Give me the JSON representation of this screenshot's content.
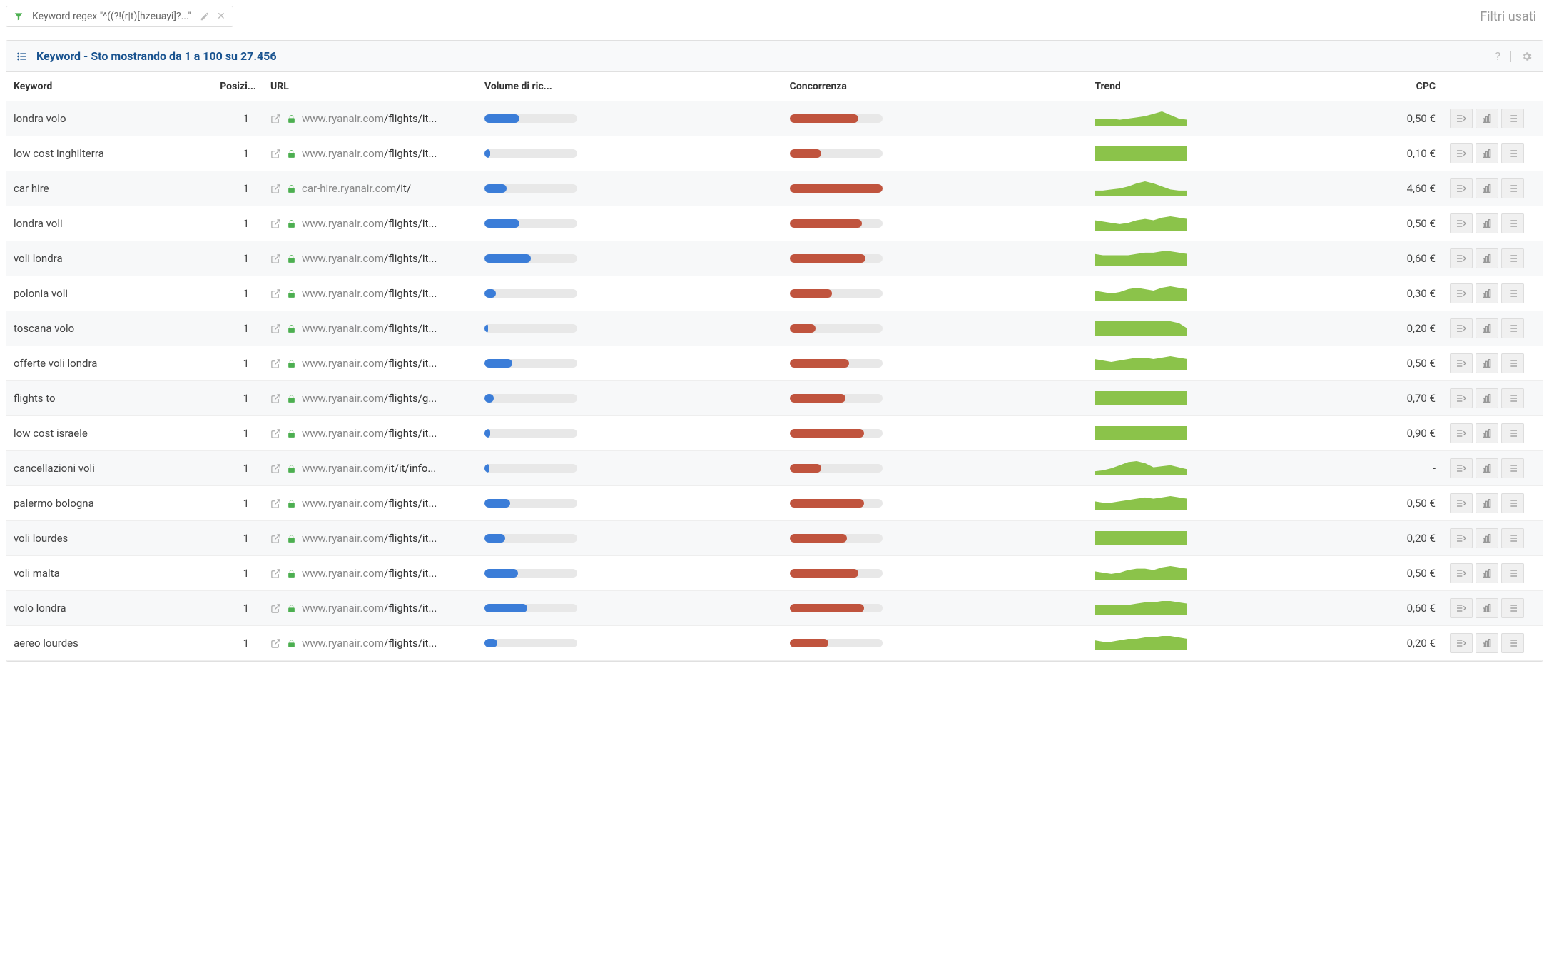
{
  "top": {
    "filter_label": "Keyword regex \"^((?!(r|t)[hzeuayi]?...\"",
    "filtri_usati": "Filtri usati"
  },
  "panel": {
    "title": "Keyword - Sto mostrando da 1 a 100 su 27.456"
  },
  "columns": {
    "keyword": "Keyword",
    "posizione": "Posizi...",
    "url": "URL",
    "volume": "Volume di ric...",
    "concorrenza": "Concorrenza",
    "trend": "Trend",
    "cpc": "CPC"
  },
  "rows": [
    {
      "keyword": "londra volo",
      "pos": "1",
      "url_gray": "www.ryanair.com",
      "url_dark": "/flights/it...",
      "vol": 38,
      "comp": 74,
      "trend": [
        6,
        6,
        6,
        5,
        6,
        7,
        8,
        10,
        12,
        9,
        6,
        5
      ],
      "cpc": "0,50 €"
    },
    {
      "keyword": "low cost inghilterra",
      "pos": "1",
      "url_gray": "www.ryanair.com",
      "url_dark": "/flights/it...",
      "vol": 6,
      "comp": 34,
      "trend": [
        8,
        8,
        8,
        8,
        8,
        8,
        8,
        8,
        8,
        8,
        8,
        8
      ],
      "cpc": "0,10 €"
    },
    {
      "keyword": "car hire",
      "pos": "1",
      "url_gray": "car-hire.ryanair.com",
      "url_dark": "/it/",
      "vol": 24,
      "comp": 100,
      "trend": [
        5,
        5,
        6,
        7,
        9,
        12,
        14,
        12,
        9,
        6,
        5,
        5
      ],
      "cpc": "4,60 €"
    },
    {
      "keyword": "londra voli",
      "pos": "1",
      "url_gray": "www.ryanair.com",
      "url_dark": "/flights/it...",
      "vol": 38,
      "comp": 78,
      "trend": [
        8,
        7,
        6,
        5,
        6,
        8,
        9,
        8,
        10,
        11,
        10,
        9
      ],
      "cpc": "0,50 €"
    },
    {
      "keyword": "voli londra",
      "pos": "1",
      "url_gray": "www.ryanair.com",
      "url_dark": "/flights/it...",
      "vol": 50,
      "comp": 82,
      "trend": [
        9,
        8,
        8,
        8,
        8,
        9,
        10,
        10,
        11,
        11,
        10,
        9
      ],
      "cpc": "0,60 €"
    },
    {
      "keyword": "polonia voli",
      "pos": "1",
      "url_gray": "www.ryanair.com",
      "url_dark": "/flights/it...",
      "vol": 12,
      "comp": 46,
      "trend": [
        7,
        6,
        5,
        6,
        8,
        9,
        8,
        7,
        9,
        10,
        9,
        8
      ],
      "cpc": "0,30 €"
    },
    {
      "keyword": "toscana volo",
      "pos": "1",
      "url_gray": "www.ryanair.com",
      "url_dark": "/flights/it...",
      "vol": 4,
      "comp": 28,
      "trend": [
        8,
        8,
        8,
        8,
        8,
        8,
        8,
        8,
        8,
        8,
        7,
        4
      ],
      "cpc": "0,20 €"
    },
    {
      "keyword": "offerte voli londra",
      "pos": "1",
      "url_gray": "www.ryanair.com",
      "url_dark": "/flights/it...",
      "vol": 30,
      "comp": 64,
      "trend": [
        8,
        7,
        6,
        7,
        8,
        9,
        9,
        8,
        9,
        10,
        9,
        8
      ],
      "cpc": "0,50 €"
    },
    {
      "keyword": "flights to",
      "pos": "1",
      "url_gray": "www.ryanair.com",
      "url_dark": "/flights/g...",
      "vol": 10,
      "comp": 60,
      "trend": [
        8,
        8,
        8,
        8,
        8,
        8,
        8,
        8,
        8,
        8,
        8,
        8
      ],
      "cpc": "0,70 €"
    },
    {
      "keyword": "low cost israele",
      "pos": "1",
      "url_gray": "www.ryanair.com",
      "url_dark": "/flights/it...",
      "vol": 6,
      "comp": 80,
      "trend": [
        8,
        8,
        8,
        8,
        8,
        8,
        8,
        8,
        8,
        8,
        8,
        8
      ],
      "cpc": "0,90 €"
    },
    {
      "keyword": "cancellazioni voli",
      "pos": "1",
      "url_gray": "www.ryanair.com",
      "url_dark": "/it/it/info...",
      "vol": 5,
      "comp": 34,
      "trend": [
        4,
        5,
        7,
        10,
        13,
        14,
        12,
        8,
        9,
        10,
        8,
        6
      ],
      "cpc": "-"
    },
    {
      "keyword": "palermo bologna",
      "pos": "1",
      "url_gray": "www.ryanair.com",
      "url_dark": "/flights/it...",
      "vol": 28,
      "comp": 80,
      "trend": [
        7,
        6,
        6,
        7,
        8,
        9,
        10,
        9,
        10,
        11,
        10,
        9
      ],
      "cpc": "0,50 €"
    },
    {
      "keyword": "voli lourdes",
      "pos": "1",
      "url_gray": "www.ryanair.com",
      "url_dark": "/flights/it...",
      "vol": 22,
      "comp": 62,
      "trend": [
        8,
        8,
        8,
        8,
        8,
        8,
        8,
        8,
        8,
        8,
        8,
        8
      ],
      "cpc": "0,20 €"
    },
    {
      "keyword": "voli malta",
      "pos": "1",
      "url_gray": "www.ryanair.com",
      "url_dark": "/flights/it...",
      "vol": 36,
      "comp": 74,
      "trend": [
        7,
        6,
        5,
        6,
        8,
        9,
        9,
        8,
        10,
        11,
        10,
        9
      ],
      "cpc": "0,50 €"
    },
    {
      "keyword": "volo londra",
      "pos": "1",
      "url_gray": "www.ryanair.com",
      "url_dark": "/flights/it...",
      "vol": 46,
      "comp": 80,
      "trend": [
        8,
        8,
        8,
        8,
        8,
        9,
        10,
        10,
        11,
        11,
        10,
        9
      ],
      "cpc": "0,60 €"
    },
    {
      "keyword": "aereo lourdes",
      "pos": "1",
      "url_gray": "www.ryanair.com",
      "url_dark": "/flights/it...",
      "vol": 14,
      "comp": 42,
      "trend": [
        7,
        6,
        6,
        7,
        8,
        8,
        9,
        9,
        10,
        10,
        9,
        8
      ],
      "cpc": "0,20 €"
    }
  ]
}
